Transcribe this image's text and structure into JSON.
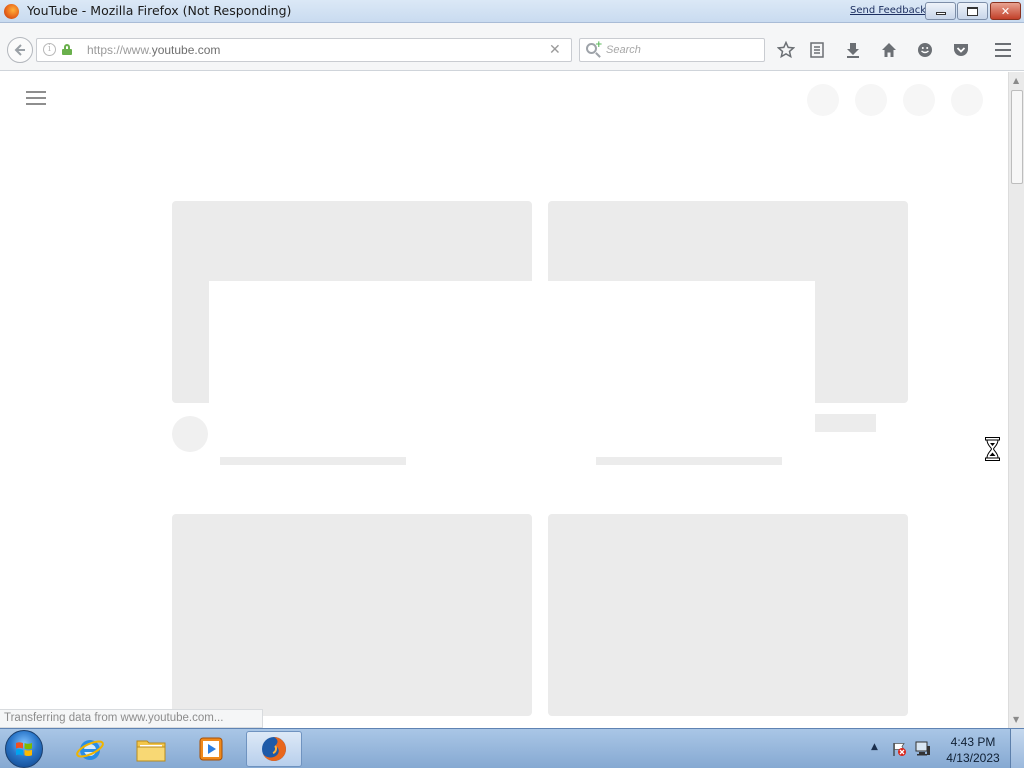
{
  "window": {
    "title": "YouTube - Mozilla Firefox (Not Responding)",
    "feedback_link": "Send Feedback"
  },
  "navbar": {
    "url_prefix": "https://www.",
    "url_host": "youtube.com",
    "search_placeholder": "Search"
  },
  "page": {
    "status_text": "Transferring data from www.youtube.com..."
  },
  "taskbar": {
    "time": "4:43 PM",
    "date": "4/13/2023"
  },
  "colors": {
    "skeleton": "#ebebeb",
    "titlebar": "#c9dbf0",
    "taskbar": "#86a9d2"
  }
}
